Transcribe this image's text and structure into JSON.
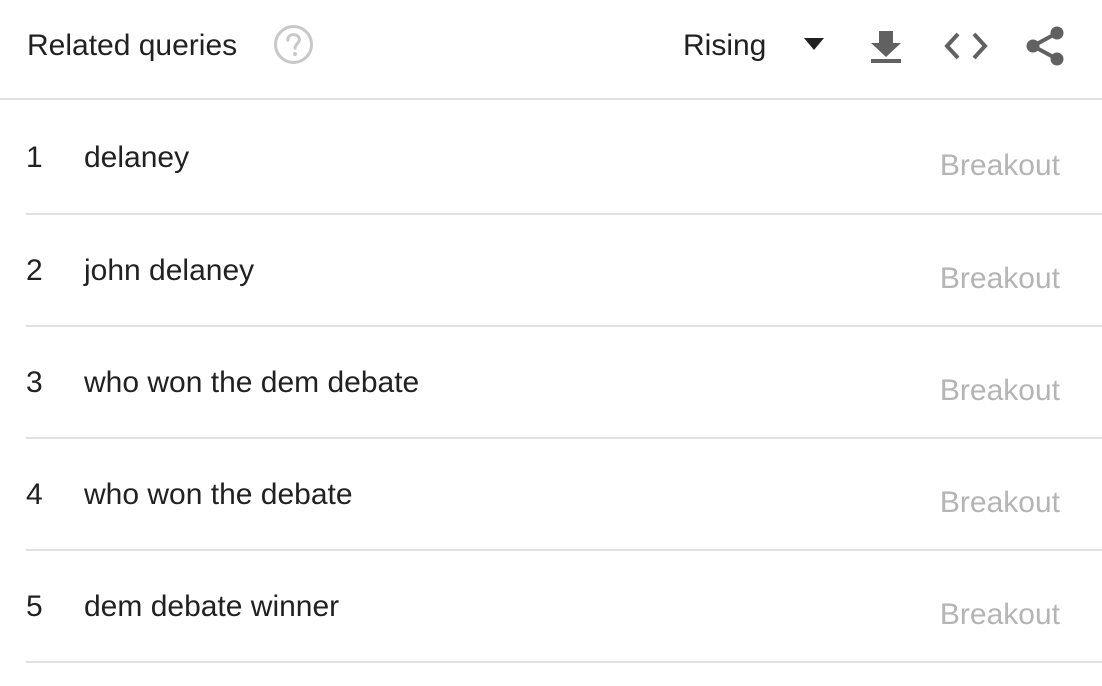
{
  "header": {
    "title": "Related queries",
    "help_icon": "help-circle-icon",
    "dropdown": {
      "selected": "Rising",
      "icon": "caret-down-icon"
    },
    "tools": [
      {
        "name": "download",
        "icon": "download-icon"
      },
      {
        "name": "embed",
        "icon": "embed-code-icon"
      },
      {
        "name": "share",
        "icon": "share-icon"
      }
    ]
  },
  "queries": [
    {
      "rank": "1",
      "query": "delaney",
      "value": "Breakout"
    },
    {
      "rank": "2",
      "query": "john delaney",
      "value": "Breakout"
    },
    {
      "rank": "3",
      "query": "who won the dem debate",
      "value": "Breakout"
    },
    {
      "rank": "4",
      "query": "who won the debate",
      "value": "Breakout"
    },
    {
      "rank": "5",
      "query": "dem debate winner",
      "value": "Breakout"
    }
  ],
  "colors": {
    "text": "#212121",
    "muted": "#b4b4b4",
    "icon": "#616161",
    "divider": "#e0e0e0"
  }
}
